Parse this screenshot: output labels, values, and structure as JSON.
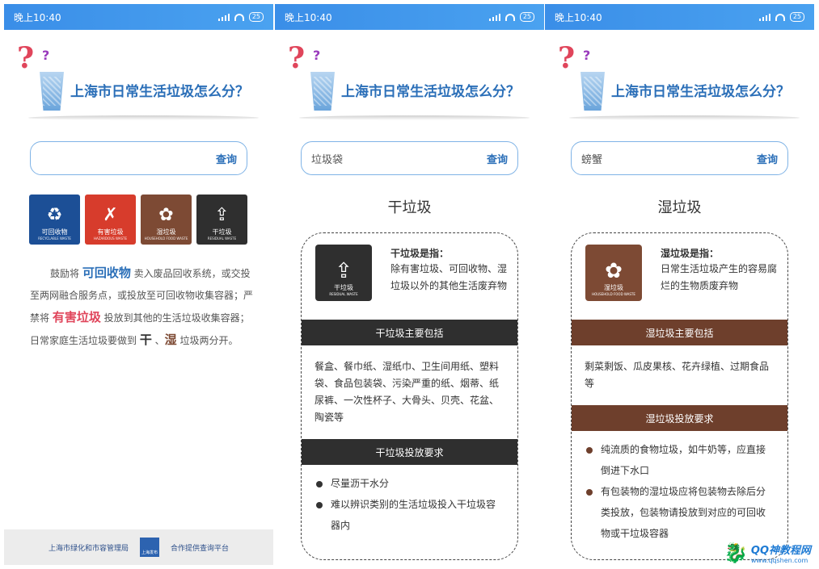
{
  "status": {
    "time": "晚上10:40",
    "battery": "25"
  },
  "header": {
    "title": "上海市日常生活垃圾怎么分？",
    "q_big": "?",
    "q_small": "?"
  },
  "screen1": {
    "search": {
      "value": "",
      "button": "查询"
    },
    "bins": [
      {
        "cn": "可回收物",
        "en": "RECYCLABLE WASTE",
        "glyph": "♻",
        "color": "#1c4f96"
      },
      {
        "cn": "有害垃圾",
        "en": "HAZARDOUS WASTE",
        "glyph": "✗",
        "color": "#d73c2c"
      },
      {
        "cn": "湿垃圾",
        "en": "HOUSEHOLD FOOD WASTE",
        "glyph": "✿",
        "color": "#7d4a34"
      },
      {
        "cn": "干垃圾",
        "en": "RESIDUAL WASTE",
        "glyph": "⇪",
        "color": "#2f2f2f"
      }
    ],
    "intro": {
      "p1": "鼓励将 ",
      "recyclable": "可回收物",
      "p2": " 卖入废品回收系统，或交投至两网融合服务点，或投放至可回收物收集容器；严禁将 ",
      "hazardous": "有害垃圾",
      "p3": " 投放到其他的生活垃圾收集容器；日常家庭生活垃圾要做到 ",
      "dry": "干",
      "sep": " 、",
      "wet": "湿",
      "p4": " 垃圾两分开。"
    },
    "footer": {
      "left": "上海市绿化和市容管理局",
      "logo": "上海发布",
      "right": "合作提供查询平台"
    }
  },
  "screen2": {
    "search": {
      "value": "垃圾袋",
      "button": "查询"
    },
    "category": "干垃圾",
    "icon": {
      "cn": "干垃圾",
      "en": "RESIDUAL WASTE",
      "glyph": "⇪"
    },
    "def_title": "干垃圾是指：",
    "def_body": "除有害垃圾、可回收物、湿垃圾以外的其他生活废弃物",
    "includes_title": "干垃圾主要包括",
    "includes_body": "餐盒、餐巾纸、湿纸巾、卫生间用纸、塑料袋、食品包装袋、污染严重的纸、烟蒂、纸尿裤、一次性杯子、大骨头、贝壳、花盆、陶瓷等",
    "rules_title": "干垃圾投放要求",
    "rules": [
      "尽量沥干水分",
      "难以辨识类别的生活垃圾投入干垃圾容器内"
    ]
  },
  "screen3": {
    "search": {
      "value": "螃蟹",
      "button": "查询"
    },
    "category": "湿垃圾",
    "icon": {
      "cn": "湿垃圾",
      "en": "HOUSEHOLD FOOD WASTE",
      "glyph": "✿"
    },
    "def_title": "湿垃圾是指：",
    "def_body": "日常生活垃圾产生的容易腐烂的生物质废弃物",
    "includes_title": "湿垃圾主要包括",
    "includes_body": "剩菜剩饭、瓜皮果核、花卉绿植、过期食品等",
    "rules_title": "湿垃圾投放要求",
    "rules": [
      "纯流质的食物垃圾，如牛奶等，应直接倒进下水口",
      "有包装物的湿垃圾应将包装物去除后分类投放，包装物请投放到对应的可回收物或干垃圾容器"
    ]
  },
  "watermark": {
    "brand": "QQ神教程网",
    "url": "www.qqshen.com"
  }
}
